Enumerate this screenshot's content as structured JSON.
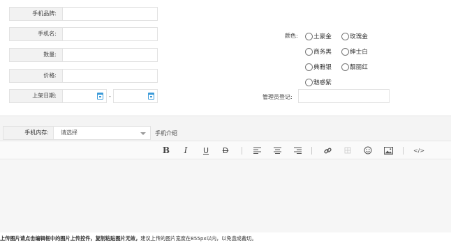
{
  "form": {
    "brand_label": "手机品牌:",
    "name_label": "手机名:",
    "qty_label": "数量:",
    "price_label": "价格:",
    "date_label": "上架日期:",
    "date_sep": "-",
    "color_label": "颜色:",
    "colors": [
      "土豪金",
      "玫瑰金",
      "商务黑",
      "绅士白",
      "典雅银",
      "靓丽红",
      "魅惑紫"
    ],
    "admin_label": "管理员登记:"
  },
  "memory": {
    "label": "手机内存:",
    "select_value": "请选择",
    "intro_label": "手机介绍"
  },
  "editor": {
    "bold": "B",
    "italic": "I",
    "underline": "U",
    "strike": "D",
    "code": "</>",
    "icons": [
      "bold-icon",
      "italic-icon",
      "underline-icon",
      "strikethrough-icon",
      "align-left-icon",
      "align-center-icon",
      "align-right-icon",
      "link-icon",
      "table-icon",
      "emoji-icon",
      "image-icon",
      "code-icon"
    ]
  },
  "footer": {
    "bold_note": "上传图片请点击编辑框中的图片上传控件，复制粘贴图片无效，",
    "note": "建议上传的图片宽度在855px以内，以免造成裁切。"
  }
}
